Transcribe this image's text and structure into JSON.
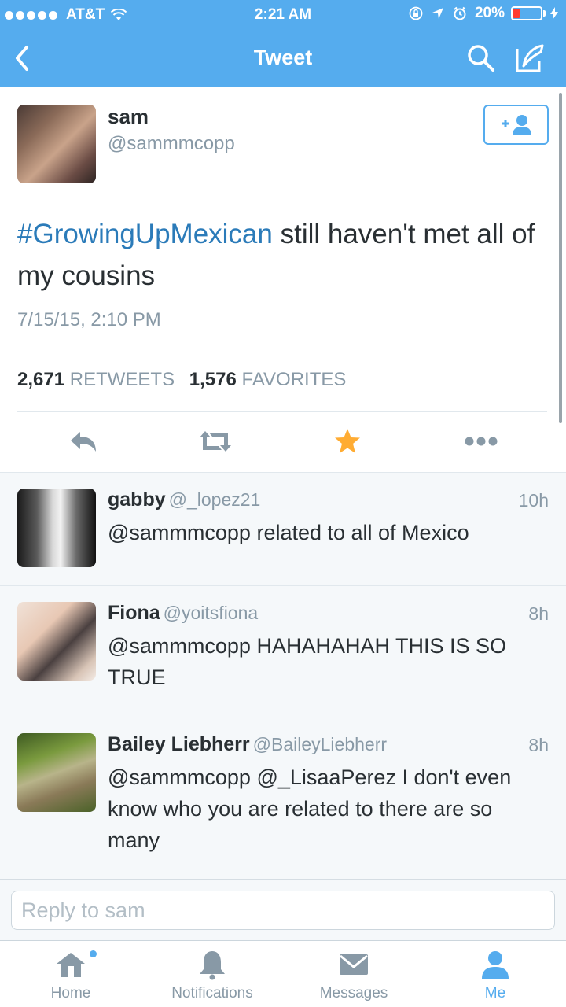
{
  "status_bar": {
    "carrier": "AT&T",
    "time": "2:21 AM",
    "battery": "20%"
  },
  "nav": {
    "title": "Tweet",
    "back_icon": "chevron-left-icon",
    "search_icon": "search-icon",
    "compose_icon": "compose-icon"
  },
  "tweet": {
    "author": {
      "name": "sam",
      "handle": "@sammmcopp"
    },
    "hashtag": "#GrowingUpMexican",
    "text": " still haven't met all of my cousins",
    "date": "7/15/15, 2:10 PM",
    "stats": {
      "retweets_count": "2,671",
      "retweets_label": "RETWEETS",
      "favorites_count": "1,576",
      "favorites_label": "FAVORITES"
    },
    "actions": [
      "reply-icon",
      "retweet-icon",
      "favorite-icon",
      "more-icon"
    ]
  },
  "replies": [
    {
      "name": "gabby",
      "handle": "@_lopez21",
      "time": "10h",
      "text": "@sammmcopp related to all of Mexico"
    },
    {
      "name": "Fiona",
      "handle": "@yoitsfiona",
      "time": "8h",
      "text": "@sammmcopp HAHAHAHAH THIS IS SO TRUE"
    },
    {
      "name": "Bailey Liebherr",
      "handle": "@BaileyLiebherr",
      "time": "8h",
      "text": "@sammmcopp @_LisaaPerez I don't even know who you are related to there are so many"
    }
  ],
  "reply_box": {
    "placeholder": "Reply to sam"
  },
  "tabs": [
    {
      "label": "Home",
      "icon": "home-icon"
    },
    {
      "label": "Notifications",
      "icon": "bell-icon"
    },
    {
      "label": "Messages",
      "icon": "envelope-icon"
    },
    {
      "label": "Me",
      "icon": "person-icon"
    }
  ],
  "colors": {
    "accent": "#55acee",
    "hashtag": "#2b7bb9",
    "favorite": "#ffac33",
    "secondary_text": "#8899a6"
  }
}
